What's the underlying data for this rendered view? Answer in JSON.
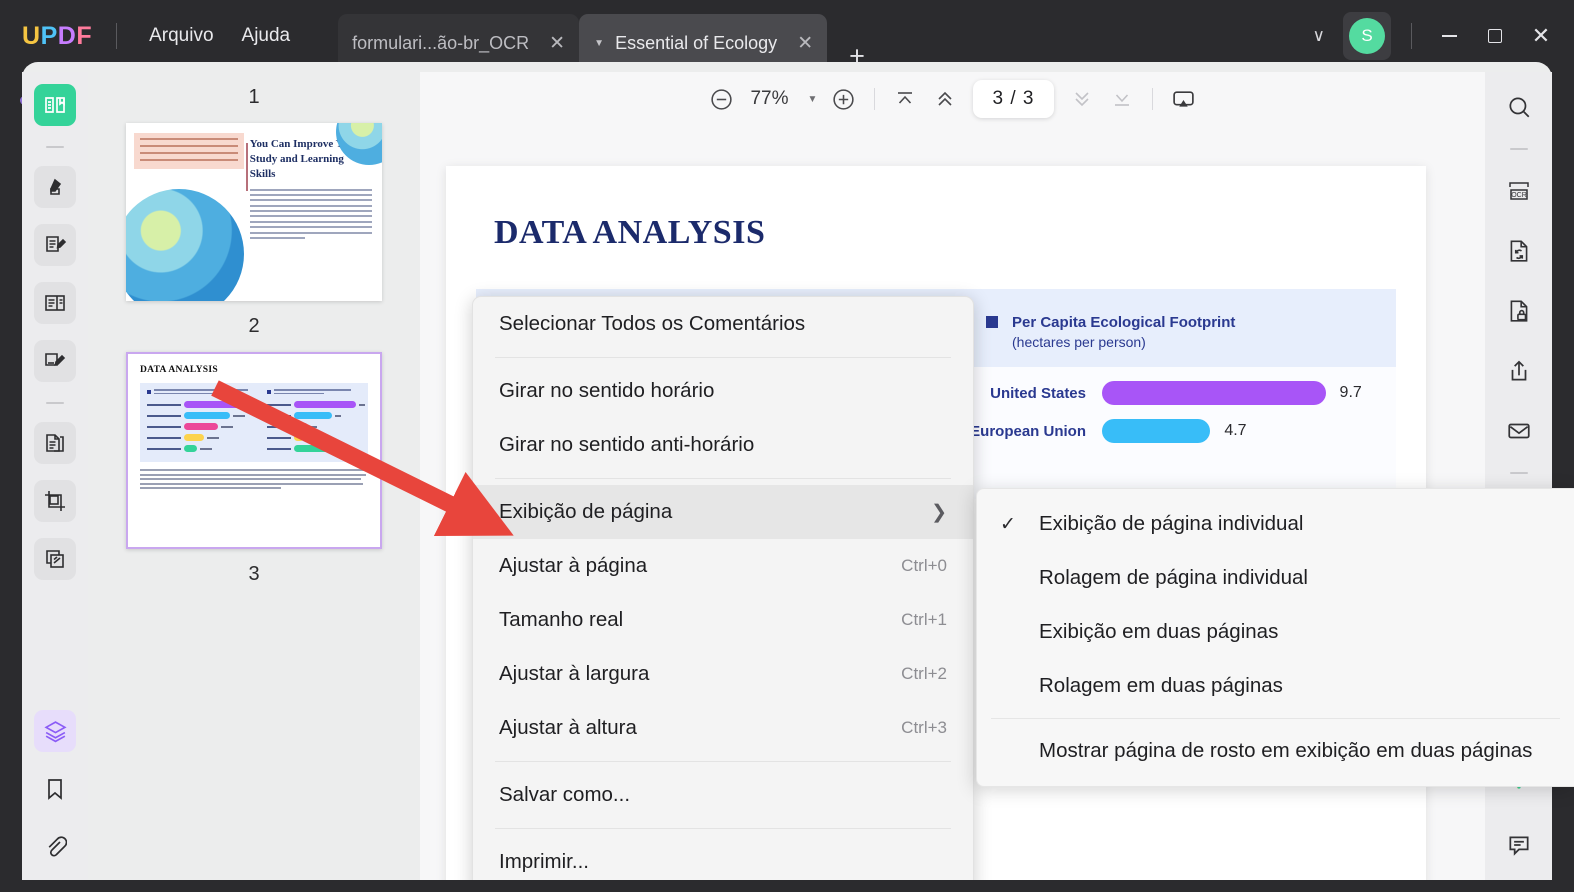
{
  "titlebar": {
    "logo": [
      "U",
      "P",
      "D",
      "F"
    ],
    "menus": [
      "Arquivo",
      "Ajuda"
    ],
    "tabs": [
      {
        "title": "formulari...ão-br_OCR",
        "close": "✕",
        "caret": ""
      },
      {
        "title": "Essential of Ecology",
        "close": "✕",
        "caret": "▼"
      }
    ],
    "add_tab": "+",
    "tab_list_caret": "∨",
    "avatar_initial": "S",
    "minimize": "—",
    "maximize": "□",
    "close": "✕"
  },
  "left_rail": {
    "items": [
      {
        "name": "reader-icon",
        "state": "active"
      },
      {
        "name": "highlighter-icon",
        "state": "normal"
      },
      {
        "name": "edit-text-icon",
        "state": "normal"
      },
      {
        "name": "form-icon",
        "state": "normal"
      },
      {
        "name": "sign-icon",
        "state": "normal"
      },
      {
        "name": "page-organize-icon",
        "state": "normal"
      },
      {
        "name": "crop-icon",
        "state": "normal"
      },
      {
        "name": "batch-icon",
        "state": "normal"
      },
      {
        "name": "layers-icon",
        "state": "selected"
      },
      {
        "name": "bookmark-icon",
        "state": "plain"
      },
      {
        "name": "attachment-icon",
        "state": "plain"
      }
    ]
  },
  "right_rail": {
    "items": [
      {
        "name": "search-icon"
      },
      {
        "name": "ocr-icon"
      },
      {
        "name": "convert-icon"
      },
      {
        "name": "protect-icon"
      },
      {
        "name": "share-icon"
      },
      {
        "name": "email-icon"
      },
      {
        "name": "ai-icon"
      },
      {
        "name": "comment-icon"
      }
    ]
  },
  "toolbar": {
    "zoom_out": "−",
    "zoom_value": "77%",
    "zoom_caret": "▼",
    "zoom_in": "+",
    "first_page": "first-page-icon",
    "prev_page": "prev-page-icon",
    "page_indicator": "3 / 3",
    "next_page": "next-page-icon",
    "last_page": "last-page-icon",
    "present": "present-icon"
  },
  "thumbnails": {
    "pages": [
      {
        "number": "1"
      },
      {
        "number": "2",
        "title_line1": "You Can Improve Your",
        "title_line2": "Study and Learning Skills"
      },
      {
        "number": "3",
        "title": "DATA ANALYSIS"
      }
    ]
  },
  "document": {
    "title": "DATA ANALYSIS"
  },
  "chart_data": {
    "type": "bar",
    "orientation": "horizontal",
    "title": "Per Capita Ecological Footprint",
    "subtitle": "(hectares per person)",
    "categories": [
      "United States",
      "European Union"
    ],
    "values": [
      9.7,
      4.7
    ],
    "value_labels": [
      "9.7",
      "4.7"
    ],
    "colors": [
      "#a855f7",
      "#38bdf8"
    ],
    "xlabel": "",
    "ylabel": "",
    "xlim": [
      0,
      10.5
    ],
    "legend_position": "top",
    "grid": false
  },
  "context_menu": {
    "items": [
      {
        "label": "Selecionar Todos os Comentários",
        "shortcut": "",
        "submenu": false,
        "highlight": false,
        "sep_after": true
      },
      {
        "label": "Girar no sentido horário",
        "shortcut": "",
        "submenu": false,
        "highlight": false,
        "sep_after": false
      },
      {
        "label": "Girar no sentido anti-horário",
        "shortcut": "",
        "submenu": false,
        "highlight": false,
        "sep_after": true
      },
      {
        "label": "Exibição de página",
        "shortcut": "",
        "submenu": true,
        "highlight": true,
        "sep_after": false
      },
      {
        "label": "Ajustar à página",
        "shortcut": "Ctrl+0",
        "submenu": false,
        "highlight": false,
        "sep_after": false
      },
      {
        "label": "Tamanho real",
        "shortcut": "Ctrl+1",
        "submenu": false,
        "highlight": false,
        "sep_after": false
      },
      {
        "label": "Ajustar à largura",
        "shortcut": "Ctrl+2",
        "submenu": false,
        "highlight": false,
        "sep_after": false
      },
      {
        "label": "Ajustar à altura",
        "shortcut": "Ctrl+3",
        "submenu": false,
        "highlight": false,
        "sep_after": true
      },
      {
        "label": "Salvar como...",
        "shortcut": "",
        "submenu": false,
        "highlight": false,
        "sep_after": true
      },
      {
        "label": "Imprimir...",
        "shortcut": "",
        "submenu": false,
        "highlight": false,
        "sep_after": false
      }
    ],
    "submenu_arrow": "❯"
  },
  "submenu": {
    "items": [
      {
        "label": "Exibição de página individual",
        "checked": true,
        "sep_after": false
      },
      {
        "label": "Rolagem de página individual",
        "checked": false,
        "sep_after": false
      },
      {
        "label": "Exibição em duas páginas",
        "checked": false,
        "sep_after": false
      },
      {
        "label": "Rolagem em duas páginas",
        "checked": false,
        "sep_after": true
      },
      {
        "label": "Mostrar página de rosto em exibição em duas páginas",
        "checked": false,
        "sep_after": false
      }
    ],
    "check_glyph": "✓"
  },
  "colors": {
    "titlebar_bg": "#2b2b2e",
    "accent_green": "#34d399",
    "accent_purple": "#8b5cf6",
    "annotation_red": "#e8453c",
    "doc_title_blue": "#1b2a6b"
  }
}
